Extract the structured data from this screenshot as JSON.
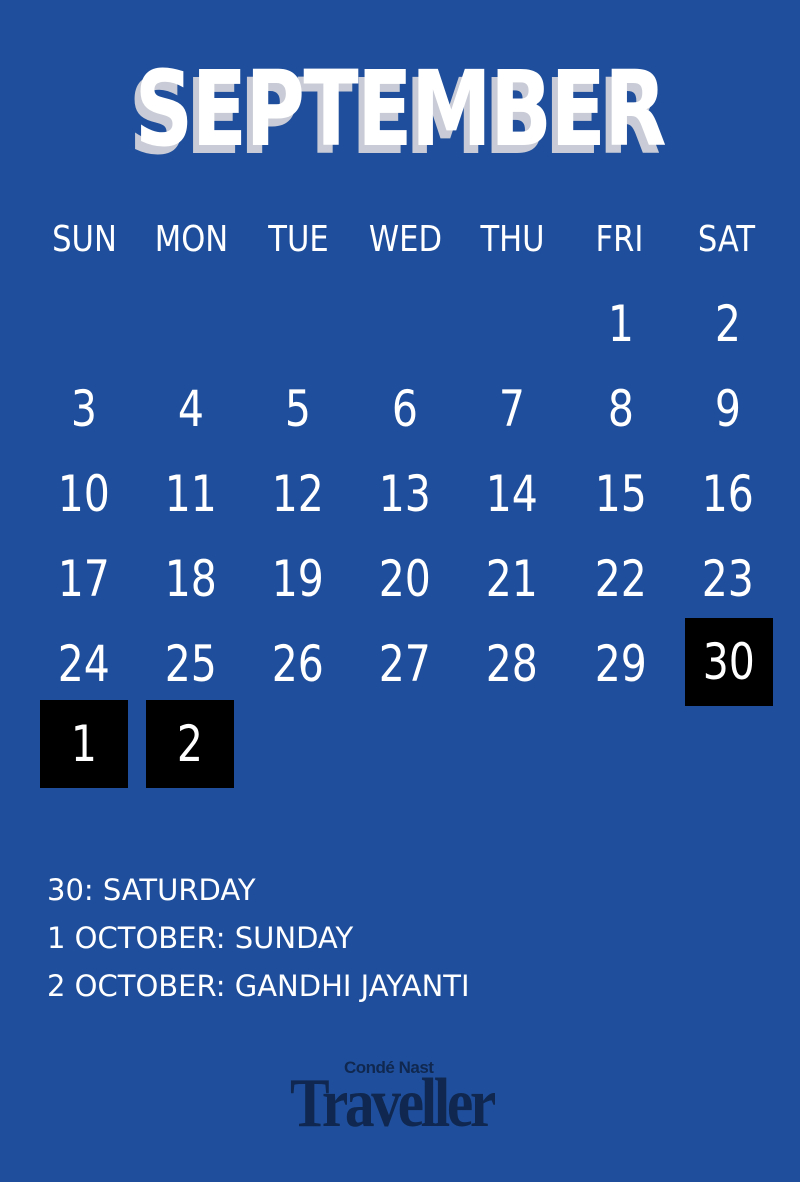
{
  "month_title": "SEPTEMBER",
  "weekdays": [
    "SUN",
    "MON",
    "TUE",
    "WED",
    "THU",
    "FRI",
    "SAT"
  ],
  "weeks": [
    [
      "",
      "",
      "",
      "",
      "",
      "1",
      "2"
    ],
    [
      "3",
      "4",
      "5",
      "6",
      "7",
      "8",
      "9"
    ],
    [
      "10",
      "11",
      "12",
      "13",
      "14",
      "15",
      "16"
    ],
    [
      "17",
      "18",
      "19",
      "20",
      "21",
      "22",
      "23"
    ],
    [
      "24",
      "25",
      "26",
      "27",
      "28",
      "29",
      "30"
    ],
    [
      "1",
      "2",
      "",
      "",
      "",
      "",
      ""
    ]
  ],
  "highlighted_dates": [
    "Sep 30",
    "Oct 1",
    "Oct 2"
  ],
  "highlight_color": "#000000",
  "background_color": "#1f4f9c",
  "notes": [
    "30: SATURDAY",
    "1 OCTOBER: SUNDAY",
    "2 OCTOBER: GANDHI JAYANTI"
  ],
  "logo": {
    "top": "Condé Nast",
    "main": "Traveller"
  }
}
